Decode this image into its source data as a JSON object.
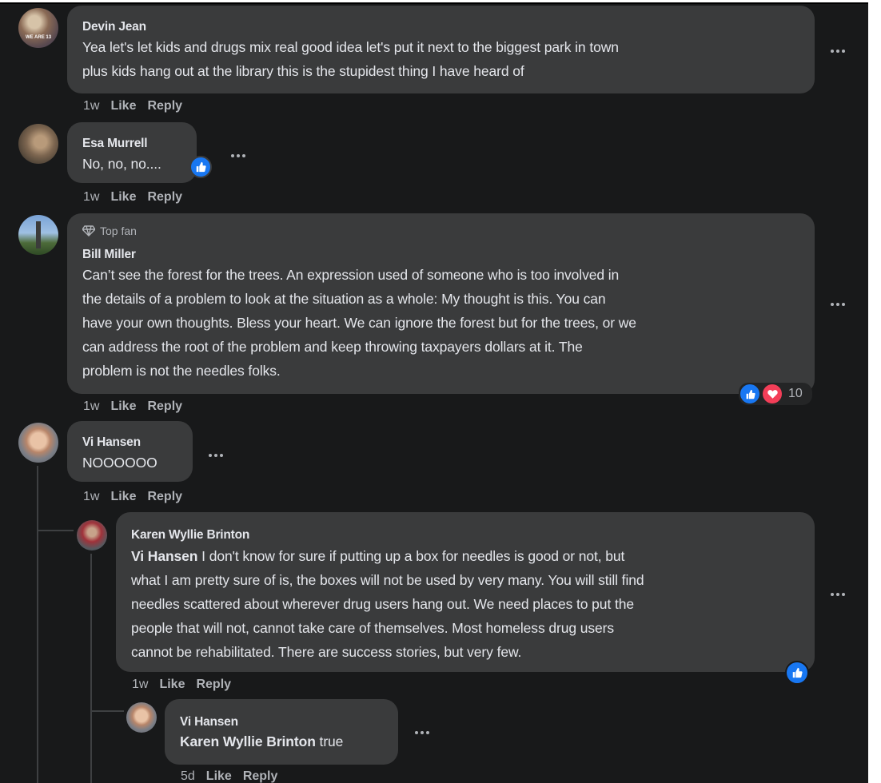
{
  "comments": [
    {
      "author": "Devin Jean",
      "avatar_caption": "WE ARE 13",
      "lines": [
        "Yea let's let kids and drugs mix real good idea let's put it next to the biggest park in town",
        "plus kids hang out at the library this is the stupidest thing I have heard of"
      ],
      "time": "1w",
      "like_label": "Like",
      "reply_label": "Reply"
    },
    {
      "author": "Esa Murrell",
      "text": "No, no, no....",
      "time": "1w",
      "like_label": "Like",
      "reply_label": "Reply"
    },
    {
      "author": "Bill Miller",
      "badge": "Top fan",
      "lines": [
        "Can’t see the forest for the trees. An expression used of someone who is too involved in",
        "the details of a problem to look at the situation as a whole: My thought is this. You can",
        "have your own thoughts. Bless your heart. We can ignore the forest but for the trees, or we",
        "can address the root of the problem and keep throwing taxpayers dollars at it. The",
        "problem is not the needles folks."
      ],
      "reaction_count": "10",
      "time": "1w",
      "like_label": "Like",
      "reply_label": "Reply"
    },
    {
      "author": "Vi Hansen",
      "text": "NOOOOOO",
      "time": "1w",
      "like_label": "Like",
      "reply_label": "Reply"
    },
    {
      "author": "Karen Wyllie Brinton",
      "mention": "Vi Hansen",
      "lines": [
        " I don't know for sure if putting up a box for needles is good or not, but",
        "what I am pretty sure of is, the boxes will not be used by very many. You will still find",
        "needles scattered about wherever drug users hang out. We need places to put the",
        "people that will not, cannot take care of themselves. Most homeless drug users",
        "cannot be rehabilitated. There are success stories, but very few."
      ],
      "time": "1w",
      "like_label": "Like",
      "reply_label": "Reply"
    },
    {
      "author": "Vi Hansen",
      "mention": "Karen Wyllie Brinton",
      "text": " true",
      "time": "5d",
      "like_label": "Like",
      "reply_label": "Reply"
    }
  ],
  "colors": {
    "background": "#18191a",
    "bubble": "#3a3b3c",
    "text": "#e4e6eb",
    "secondary_text": "#b0b3b8",
    "like_blue": "#1877f2",
    "love_red": "#f33e58"
  },
  "icons": [
    "more-options-icon",
    "like-reaction-icon",
    "love-reaction-icon",
    "diamond-icon"
  ]
}
